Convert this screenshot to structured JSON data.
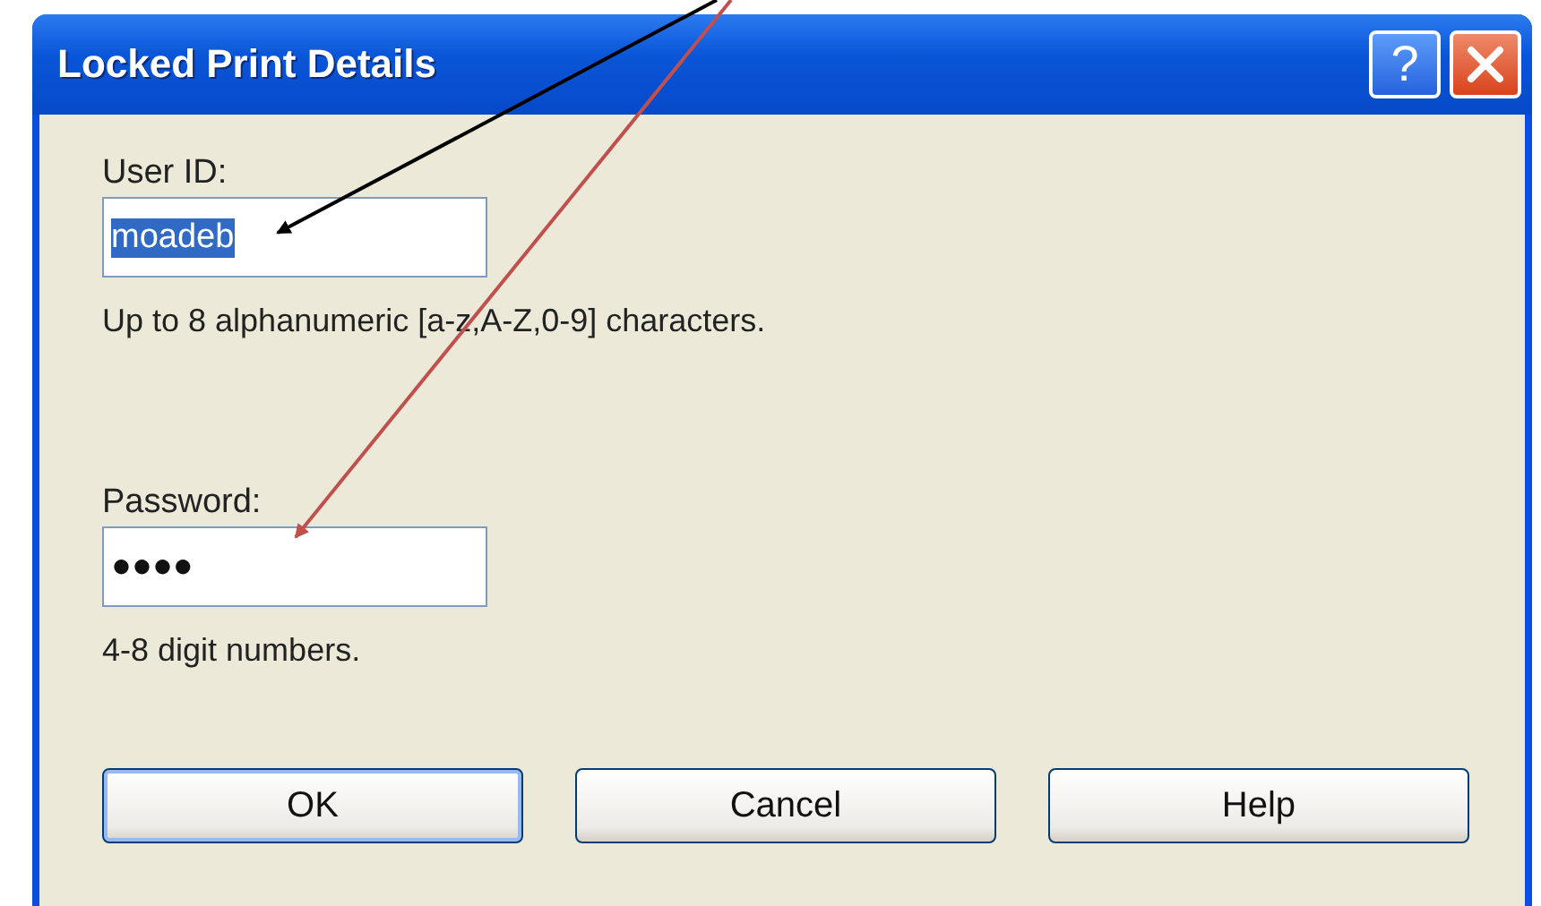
{
  "window": {
    "title": "Locked Print Details"
  },
  "title_buttons": [
    {
      "kind": "help",
      "label": "?"
    },
    {
      "kind": "close"
    }
  ],
  "fields": [
    {
      "label": "User ID:",
      "value": "moadeb",
      "text_selected": true,
      "hint": "Up to 8 alphanumeric [a-z,A-Z,0-9] characters."
    },
    {
      "label": "Password:",
      "value": "●●●●",
      "text_selected": false,
      "hint": "4-8 digit numbers."
    }
  ],
  "buttons": [
    {
      "label": "OK",
      "default": true
    },
    {
      "label": "Cancel",
      "default": false
    },
    {
      "label": "Help",
      "default": false
    }
  ],
  "annotations": [
    {
      "kind": "arrow",
      "color": "#000000"
    },
    {
      "kind": "arrow",
      "color": "#c0504d"
    }
  ]
}
